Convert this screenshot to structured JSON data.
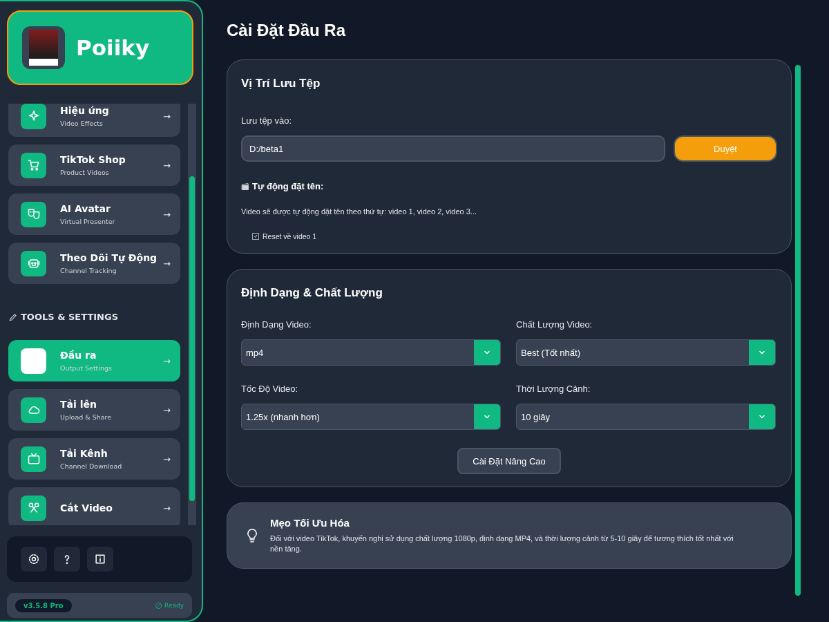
{
  "brand": {
    "name": "Poiiky"
  },
  "nav_groups": [
    {
      "items": [
        {
          "title": "Hiệu ứng",
          "subtitle": "Video Effects",
          "selected": false
        },
        {
          "title": "TikTok Shop",
          "subtitle": "Product Videos",
          "selected": false
        },
        {
          "title": "AI Avatar",
          "subtitle": "Virtual Presenter",
          "selected": false
        },
        {
          "title": "Theo Dõi Tự Động",
          "subtitle": "Channel Tracking",
          "selected": false
        }
      ]
    },
    {
      "heading": "TOOLS & SETTINGS",
      "items": [
        {
          "title": "Đầu ra",
          "subtitle": "Output Settings",
          "selected": true
        },
        {
          "title": "Tải lên",
          "subtitle": "Upload & Share",
          "selected": false
        },
        {
          "title": "Tải Kênh",
          "subtitle": "Channel Download",
          "selected": false
        },
        {
          "title": "Cắt Video",
          "selected": false
        }
      ]
    }
  ],
  "arrow": "→",
  "status_bar": {
    "version": "v3.5.8 Pro",
    "status": "Ready"
  },
  "page_title": "Cài Đặt Đầu Ra",
  "file_location": {
    "title": "Vị Trí Lưu Tệp",
    "label": "Lưu tệp vào:",
    "path": "D:/beta1",
    "browse_button": "Duyệt",
    "auto_name_title": "Tự động đặt tên:",
    "auto_name_text": "Video sẽ được tự động đặt tên theo thứ tự: video 1, video 2, video 3...",
    "reset": {
      "label": "Reset về video 1",
      "checked": true
    }
  },
  "format_quality": {
    "title": "Định Dạng & Chất Lượng",
    "fields": [
      {
        "label": "Định Dạng Video:",
        "value": "mp4"
      },
      {
        "label": "Chất Lượng Video:",
        "value": "Best (Tốt nhất)"
      },
      {
        "label": "Tốc Độ Video:",
        "value": "1.25x (nhanh hơn)"
      },
      {
        "label": "Thời Lượng Cảnh:",
        "value": "10 giây"
      }
    ],
    "advanced_button": "Cài Đặt Nâng Cao"
  },
  "tip": {
    "title": "Mẹo Tối Ưu Hóa",
    "text": "Đối với video TikTok, khuyến nghị sử dụng chất lượng 1080p, định dạng MP4, và thời lượng cảnh từ 5-10 giây để tương thích tốt nhất với nền tảng."
  }
}
